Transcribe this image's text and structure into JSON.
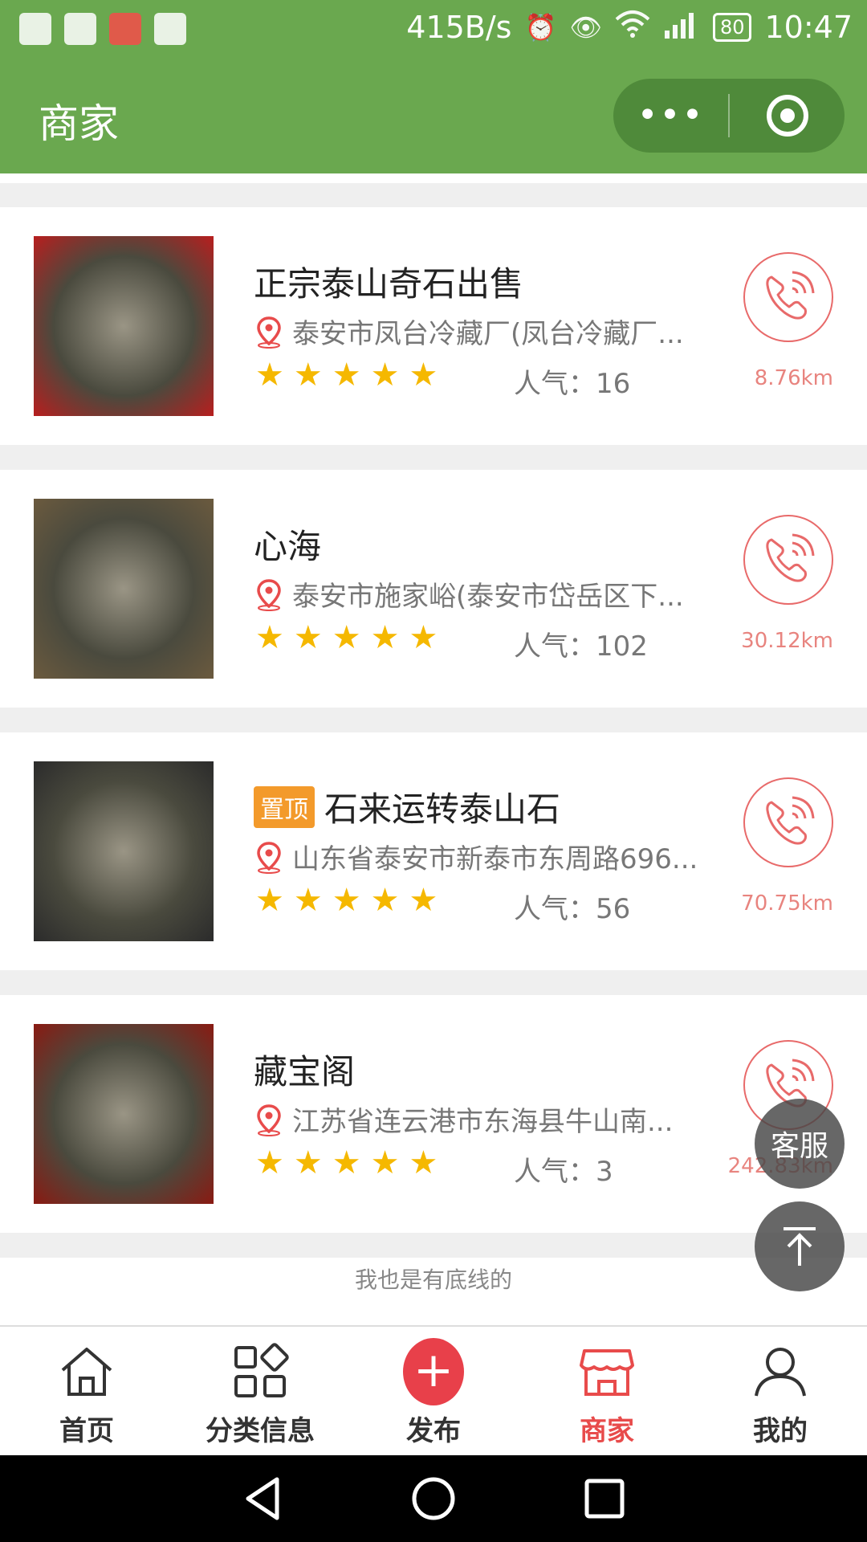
{
  "status_bar": {
    "speed": "415B/s",
    "network": "4G",
    "battery": "80",
    "time": "10:47"
  },
  "header": {
    "title": "商家",
    "more_label": "•••"
  },
  "merchants": [
    {
      "name": "正宗泰山奇石出售",
      "pinned": false,
      "address": "泰安市凤台冷藏厂(凤台冷藏厂...",
      "rating": 5,
      "popularity": "人气：16",
      "distance": "8.76km",
      "thumb_color": "#b81e1e"
    },
    {
      "name": "心海",
      "pinned": false,
      "address": "泰安市施家峪(泰安市岱岳区下...",
      "rating": 5,
      "popularity": "人气：102",
      "distance": "30.12km",
      "thumb_color": "#6b5a3e"
    },
    {
      "name": "石来运转泰山石",
      "pinned": true,
      "pin_label": "置顶",
      "address": "山东省泰安市新泰市东周路696...",
      "rating": 5,
      "popularity": "人气：56",
      "distance": "70.75km",
      "thumb_color": "#2b2b2b"
    },
    {
      "name": "藏宝阁",
      "pinned": false,
      "address": "江苏省连云港市东海县牛山南...",
      "rating": 5,
      "popularity": "人气：3",
      "distance": "242.83km",
      "thumb_color": "#8a1a12"
    }
  ],
  "footer_tip": "我也是有底线的",
  "floating": {
    "service_label": "客服"
  },
  "tabs": [
    {
      "label": "首页",
      "icon": "home-icon",
      "active": false
    },
    {
      "label": "分类信息",
      "icon": "category-icon",
      "active": false
    },
    {
      "label": "发布",
      "icon": "publish-icon",
      "active": false
    },
    {
      "label": "商家",
      "icon": "store-icon",
      "active": true
    },
    {
      "label": "我的",
      "icon": "profile-icon",
      "active": false
    }
  ],
  "colors": {
    "header_green": "#6aa84f",
    "accent_red": "#e84b4b",
    "star_yellow": "#f5b800",
    "pin_orange": "#f39a2b"
  }
}
